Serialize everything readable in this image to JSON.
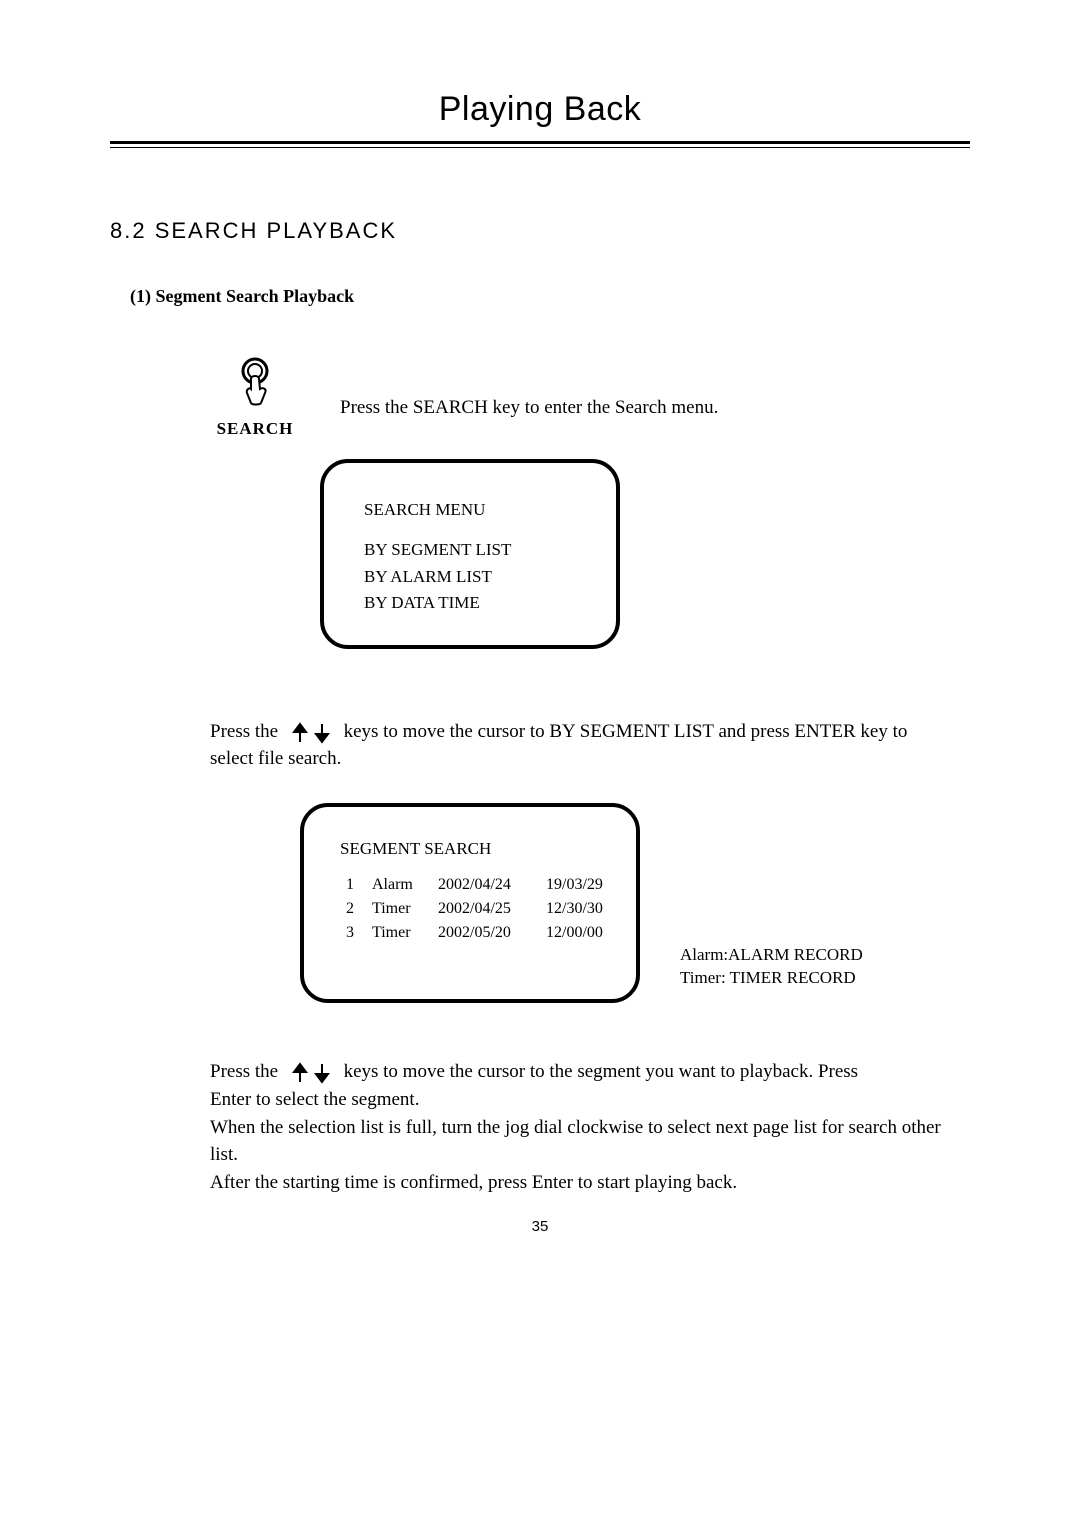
{
  "header": {
    "title": "Playing Back"
  },
  "section": {
    "heading": "8.2 SEARCH PLAYBACK"
  },
  "subsection": {
    "label": "(1) Segment Search Playback"
  },
  "search_key": {
    "label": "SEARCH",
    "instruction": "Press the SEARCH key to enter the Search menu."
  },
  "search_menu": {
    "title": "SEARCH  MENU",
    "items": [
      "BY   SEGMENT  LIST",
      "BY   ALARM   LIST",
      "BY   DATA   TIME"
    ]
  },
  "instr1": {
    "pre": "Press the ",
    "mid": " keys to move the cursor to BY SEGMENT  LIST and press ENTER key to",
    "line2": "select file search."
  },
  "segment_search": {
    "title": "SEGMENT  SEARCH",
    "rows": [
      {
        "idx": "1",
        "type": "Alarm",
        "date": "2002/04/24",
        "time": "19/03/29"
      },
      {
        "idx": "2",
        "type": "Timer",
        "date": "2002/04/25",
        "time": "12/30/30"
      },
      {
        "idx": "3",
        "type": "Timer",
        "date": "2002/05/20",
        "time": "12/00/00"
      }
    ]
  },
  "legend": {
    "l1": "Alarm:ALARM RECORD",
    "l2": "Timer: TIMER RECORD"
  },
  "instr2": {
    "pre": "Press the ",
    "mid": " keys to move the cursor to the segment you want to playback. Press",
    "line2": "Enter to select the segment.",
    "line3": "When the selection list is full, turn the jog dial  clockwise to select next page list for search other list.",
    "line4": "After the starting time is confirmed, press Enter to start playing back."
  },
  "page_number": "35"
}
